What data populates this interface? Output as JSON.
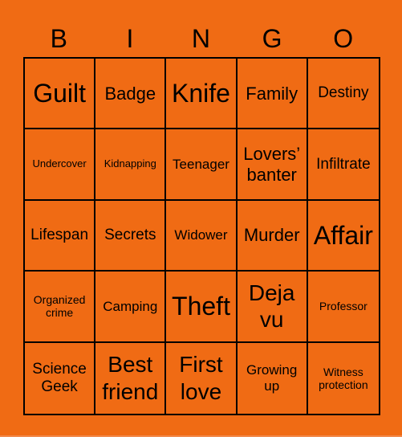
{
  "header": {
    "letters": [
      "B",
      "I",
      "N",
      "G",
      "O"
    ]
  },
  "colors": {
    "background": "#f06b14",
    "grid_line": "#000000",
    "text": "#000000"
  },
  "cells": [
    [
      "Guilt",
      "Badge",
      "Knife",
      "Family",
      "Destiny"
    ],
    [
      "Undercover",
      "Kidnapping",
      "Teenager",
      "Lovers’ banter",
      "Infiltrate"
    ],
    [
      "Lifespan",
      "Secrets",
      "Widower",
      "Murder",
      "Affair"
    ],
    [
      "Organized crime",
      "Camping",
      "Theft",
      "Deja vu",
      "Professor"
    ],
    [
      "Science Geek",
      "Best friend",
      "First love",
      "Growing up",
      "Witness protection"
    ]
  ]
}
